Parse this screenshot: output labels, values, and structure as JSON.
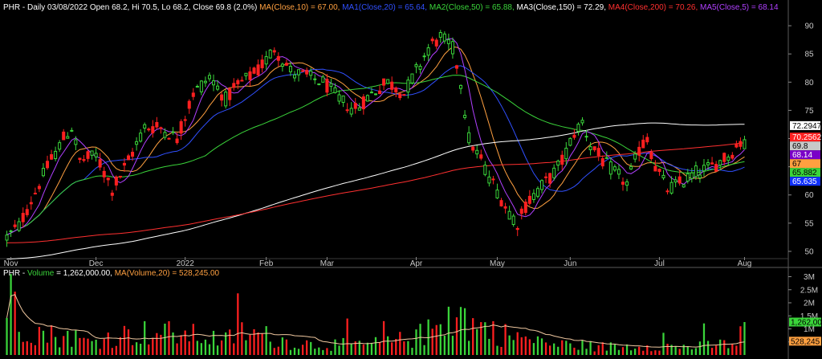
{
  "header": {
    "price_segments": [
      {
        "text": "PHR - Daily 03/08/2022 Open 68.2, Hi 70.5, Lo 68.2, Close 69.8 (2.0%) ",
        "color": "#ffffff"
      },
      {
        "text": "MA(Close,10) = 67.00, ",
        "color": "#ffa040"
      },
      {
        "text": "MA1(Close,20) = 65.64, ",
        "color": "#3050ff"
      },
      {
        "text": "MA2(Close,50) = 65.88, ",
        "color": "#3ad43a"
      },
      {
        "text": "MA3(Close,150) = 72.29, ",
        "color": "#ffffff"
      },
      {
        "text": "MA4(Close,200) = 70.26, ",
        "color": "#ff3030"
      },
      {
        "text": "MA5(Close,5) = 68.14",
        "color": "#b040ff"
      }
    ],
    "volume_segments": [
      {
        "text": "PHR - ",
        "color": "#ffffff"
      },
      {
        "text": "Volume",
        "color": "#3ad43a"
      },
      {
        "text": " = 1,262,000.00, ",
        "color": "#ffffff"
      },
      {
        "text": "MA(Volume,20) = 528,245.00",
        "color": "#ffa040"
      }
    ]
  },
  "chart_data": [
    {
      "type": "candlestick",
      "title": "PHR - Daily",
      "ylim": [
        49,
        92
      ],
      "y_ticks": [
        50,
        55,
        60,
        65,
        70,
        75,
        80,
        85,
        90
      ],
      "x_ticks": [
        {
          "label": "Nov",
          "index": 1
        },
        {
          "label": "Dec",
          "index": 22
        },
        {
          "label": "2022",
          "index": 44
        },
        {
          "label": "Feb",
          "index": 64
        },
        {
          "label": "Mar",
          "index": 79
        },
        {
          "label": "Apr",
          "index": 101
        },
        {
          "label": "May",
          "index": 121
        },
        {
          "label": "Jun",
          "index": 139
        },
        {
          "label": "Jul",
          "index": 161
        },
        {
          "label": "Aug",
          "index": 182
        }
      ],
      "last": {
        "open": 68.2,
        "high": 70.5,
        "low": 68.2,
        "close": 69.8,
        "change": "2.0%"
      },
      "up_color": "#3ad43a",
      "down_color": "#ff2020",
      "waypoints": [
        [
          0,
          52.5
        ],
        [
          3,
          54.5
        ],
        [
          6,
          59
        ],
        [
          10,
          65
        ],
        [
          14,
          70
        ],
        [
          16,
          72
        ],
        [
          18,
          66
        ],
        [
          22,
          67
        ],
        [
          26,
          61
        ],
        [
          30,
          66
        ],
        [
          34,
          72
        ],
        [
          38,
          72
        ],
        [
          42,
          70
        ],
        [
          46,
          78
        ],
        [
          50,
          81
        ],
        [
          54,
          77
        ],
        [
          58,
          80
        ],
        [
          62,
          82
        ],
        [
          66,
          86
        ],
        [
          70,
          82
        ],
        [
          74,
          81
        ],
        [
          78,
          80
        ],
        [
          82,
          77
        ],
        [
          86,
          75
        ],
        [
          90,
          78
        ],
        [
          94,
          80
        ],
        [
          98,
          78
        ],
        [
          101,
          82
        ],
        [
          104,
          86
        ],
        [
          107,
          88
        ],
        [
          110,
          86
        ],
        [
          112,
          80
        ],
        [
          114,
          70
        ],
        [
          117,
          66
        ],
        [
          120,
          62
        ],
        [
          123,
          58
        ],
        [
          126,
          55
        ],
        [
          128,
          58
        ],
        [
          131,
          61
        ],
        [
          134,
          63
        ],
        [
          137,
          66
        ],
        [
          140,
          71
        ],
        [
          142,
          73
        ],
        [
          144,
          69
        ],
        [
          147,
          66
        ],
        [
          150,
          64
        ],
        [
          153,
          62
        ],
        [
          156,
          68
        ],
        [
          158,
          70
        ],
        [
          160,
          65
        ],
        [
          163,
          61
        ],
        [
          166,
          62
        ],
        [
          170,
          64
        ],
        [
          174,
          65
        ],
        [
          178,
          67
        ],
        [
          182,
          70
        ]
      ],
      "series": [
        {
          "name": "MA(Close,10)",
          "color": "#ffa040",
          "last": 67.0
        },
        {
          "name": "MA1(Close,20)",
          "color": "#3050ff",
          "last": 65.64
        },
        {
          "name": "MA2(Close,50)",
          "color": "#3ad43a",
          "last": 65.88
        },
        {
          "name": "MA3(Close,150)",
          "color": "#ffffff",
          "last": 72.29
        },
        {
          "name": "MA4(Close,200)",
          "color": "#ff3030",
          "last": 70.26
        },
        {
          "name": "MA5(Close,5)",
          "color": "#b040ff",
          "last": 68.14
        }
      ],
      "right_badges": [
        {
          "text": "72.2947",
          "value": 72.2947,
          "bg": "#ffffff",
          "fg": "#000000"
        },
        {
          "text": "70.2562",
          "value": 70.2562,
          "bg": "#ff2020",
          "fg": "#ffffff"
        },
        {
          "text": "69.8",
          "value": 69.8,
          "bg": "#c8c8c8",
          "fg": "#000000"
        },
        {
          "text": "68.14",
          "value": 68.14,
          "bg": "#7a00c8",
          "fg": "#ffffff"
        },
        {
          "text": "67",
          "value": 67.0,
          "bg": "#ffa040",
          "fg": "#000000"
        },
        {
          "text": "65.882",
          "value": 65.882,
          "bg": "#3ad43a",
          "fg": "#000000"
        },
        {
          "text": "65.635",
          "value": 65.635,
          "bg": "#1030ff",
          "fg": "#ffffff"
        }
      ]
    },
    {
      "type": "bar",
      "title": "PHR - Volume",
      "ylim": [
        0,
        3200000
      ],
      "y_ticks": [
        {
          "label": "3M",
          "value": 3000000
        },
        {
          "label": "2.5M",
          "value": 2500000
        },
        {
          "label": "2M",
          "value": 2000000
        },
        {
          "label": "1.5M",
          "value": 1500000
        },
        {
          "label": "1M",
          "value": 1000000
        },
        {
          "label": "500K",
          "value": 500000
        }
      ],
      "volume": {
        "last": 1262000,
        "ma20": 528245
      },
      "waypoints_vol": [
        [
          0,
          1.2
        ],
        [
          2,
          2.9
        ],
        [
          4,
          1.5
        ],
        [
          8,
          1.1
        ],
        [
          12,
          0.9
        ],
        [
          16,
          0.9
        ],
        [
          20,
          0.6
        ],
        [
          24,
          0.8
        ],
        [
          30,
          1.0
        ],
        [
          36,
          1.1
        ],
        [
          42,
          1.0
        ],
        [
          48,
          0.9
        ],
        [
          54,
          0.7
        ],
        [
          58,
          1.1
        ],
        [
          64,
          0.9
        ],
        [
          70,
          0.6
        ],
        [
          76,
          0.5
        ],
        [
          82,
          0.5
        ],
        [
          88,
          0.5
        ],
        [
          94,
          0.6
        ],
        [
          100,
          0.8
        ],
        [
          104,
          1.1
        ],
        [
          106,
          1.3
        ],
        [
          108,
          1.8
        ],
        [
          110,
          1.5
        ],
        [
          112,
          2.0
        ],
        [
          114,
          1.5
        ],
        [
          118,
          1.3
        ],
        [
          122,
          1.0
        ],
        [
          126,
          0.9
        ],
        [
          130,
          0.6
        ],
        [
          136,
          0.5
        ],
        [
          140,
          0.5
        ],
        [
          146,
          0.4
        ],
        [
          152,
          0.4
        ],
        [
          158,
          0.5
        ],
        [
          164,
          0.4
        ],
        [
          170,
          0.4
        ],
        [
          176,
          0.5
        ],
        [
          180,
          0.6
        ],
        [
          182,
          1.262
        ]
      ],
      "ma_color": "#f0c8a0",
      "right_badges": [
        {
          "text": "1,262,000",
          "value": 1262000,
          "bg": "#3ad43a",
          "fg": "#000000"
        },
        {
          "text": "528,245",
          "value": 528245,
          "bg": "#ffa040",
          "fg": "#000000"
        }
      ]
    }
  ]
}
